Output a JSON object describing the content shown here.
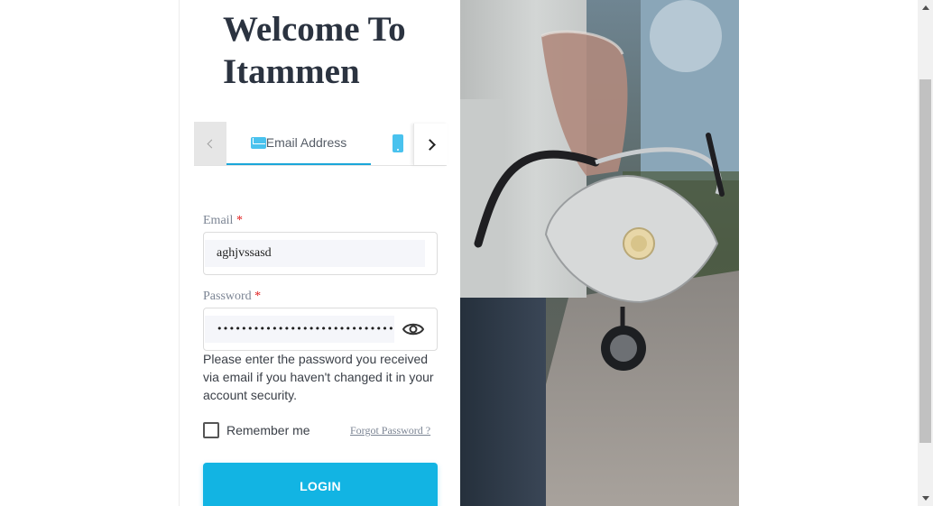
{
  "header": {
    "title": "Welcome To Itammen"
  },
  "tabs": {
    "active": "Email Address",
    "items": [
      {
        "label": "Email Address",
        "icon": "envelope-icon"
      },
      {
        "label": "",
        "icon": "phone-icon"
      }
    ]
  },
  "form": {
    "email": {
      "label": "Email",
      "required_mark": "*",
      "value": "aghjvssasd"
    },
    "password": {
      "label": "Password",
      "required_mark": "*",
      "masked_value": "•••••••••••••••••••••••••••••"
    },
    "hint": "Please enter the password you received via email if you haven't changed it in your account security.",
    "remember_label": "Remember me",
    "remember_checked": false,
    "forgot_label": "Forgot Password ?",
    "submit_label": "LOGIN"
  },
  "colors": {
    "accent": "#12b4e3",
    "tab_underline": "#1aa6d9",
    "required": "#e01b1b",
    "title": "#2b3340"
  }
}
